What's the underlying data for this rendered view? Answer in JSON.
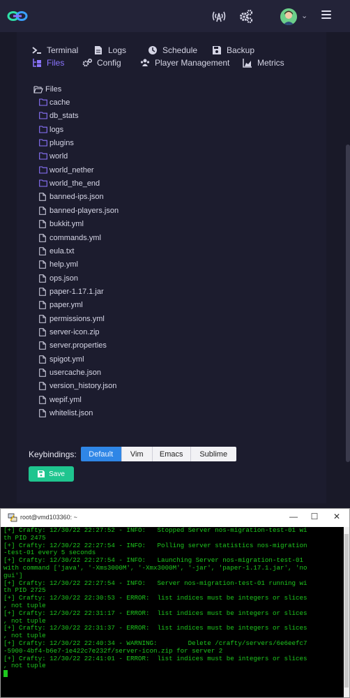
{
  "topbar": {
    "logo_icon": "crafty-link-logo-icon",
    "status_icon": "antenna-signal-icon",
    "settings_icon": "cogs-icon",
    "avatar_icon": "user-avatar",
    "caret_icon": "chevron-down-icon",
    "menu_icon": "hamburger-menu-icon"
  },
  "tabs": [
    {
      "label": "Terminal",
      "icon": "terminal-icon"
    },
    {
      "label": "Logs",
      "icon": "file-lines-icon"
    },
    {
      "label": "Schedule",
      "icon": "clock-icon"
    },
    {
      "label": "Backup",
      "icon": "save-icon"
    },
    {
      "label": "Files",
      "icon": "folder-tree-icon",
      "active": true
    },
    {
      "label": "Config",
      "icon": "cogs-icon"
    },
    {
      "label": "Player Management",
      "icon": "users-icon"
    },
    {
      "label": "Metrics",
      "icon": "chart-area-icon"
    }
  ],
  "files": {
    "root": "Files",
    "folders": [
      "cache",
      "db_stats",
      "logs",
      "plugins",
      "world",
      "world_nether",
      "world_the_end"
    ],
    "files": [
      "banned-ips.json",
      "banned-players.json",
      "bukkit.yml",
      "commands.yml",
      "eula.txt",
      "help.yml",
      "ops.json",
      "paper-1.17.1.jar",
      "paper.yml",
      "permissions.yml",
      "server-icon.zip",
      "server.properties",
      "spigot.yml",
      "usercache.json",
      "version_history.json",
      "wepif.yml",
      "whitelist.json"
    ]
  },
  "keybindings": {
    "label": "Keybindings:",
    "options": [
      "Default",
      "Vim",
      "Emacs",
      "Sublime"
    ],
    "selected": "Default"
  },
  "save": {
    "label": "Save",
    "icon": "floppy-disk-icon"
  },
  "terminal": {
    "title": "root@vmd103360: ~",
    "minimize": "—",
    "maximize": "☐",
    "close": "✕",
    "lines": [
      "[+] Crafty: 12/30/22 22:27:52 - INFO:   Stopped Server nos-migration-test-01 wi",
      "th PID 2475",
      "[+] Crafty: 12/30/22 22:27:54 - INFO:   Polling server statistics nos-migration",
      "-test-01 every 5 seconds",
      "[+] Crafty: 12/30/22 22:27:54 - INFO:   Launching Server nos-migration-test-01",
      "with command ['java', '-Xms3000M', '-Xmx3000M', '-jar', 'paper-1.17.1.jar', 'no",
      "gui']",
      "[+] Crafty: 12/30/22 22:27:54 - INFO:   Server nos-migration-test-01 running wi",
      "th PID 2725",
      "[+] Crafty: 12/30/22 22:30:53 - ERROR:  list indices must be integers or slices",
      ", not tuple",
      "[+] Crafty: 12/30/22 22:31:17 - ERROR:  list indices must be integers or slices",
      ", not tuple",
      "[+] Crafty: 12/30/22 22:31:37 - ERROR:  list indices must be integers or slices",
      ", not tuple",
      "[+] Crafty: 12/30/22 22:40:34 - WARNING:        Delete /crafty/servers/6e6eefc7",
      "-5900-4bf4-b6e7-1e422c7e232f/server-icon.zip for server 2",
      "[+] Crafty: 12/30/22 22:41:01 - ERROR:  list indices must be integers or slices",
      ", not tuple"
    ]
  }
}
